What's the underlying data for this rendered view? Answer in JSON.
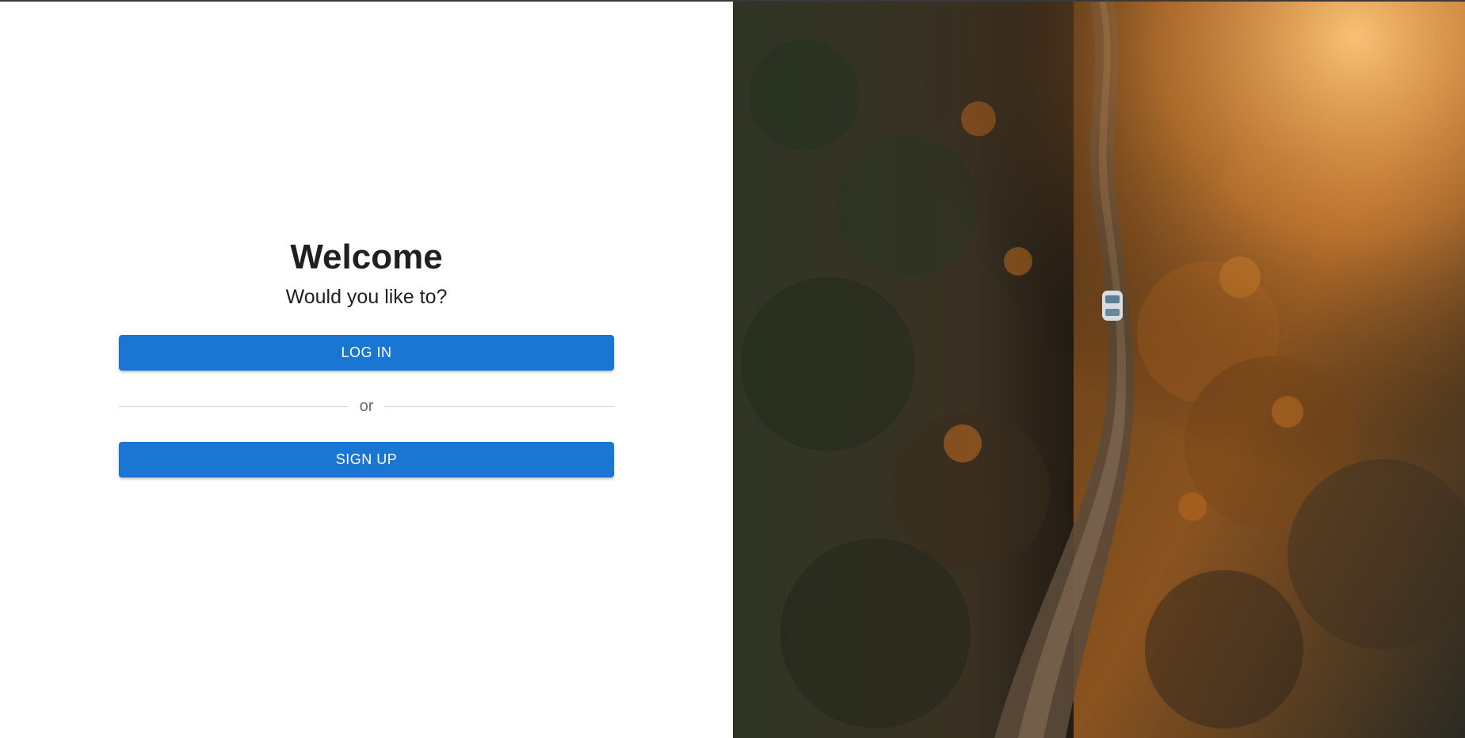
{
  "welcome": {
    "title": "Welcome",
    "subtitle": "Would you like to?"
  },
  "actions": {
    "login_label": "LOG IN",
    "divider_label": "or",
    "signup_label": "SIGN UP"
  },
  "hero_image": {
    "description_icon": "forest-road-photo-icon"
  },
  "colors": {
    "primary": "#1976d2",
    "text": "#202020",
    "divider": "#d9d9d9"
  }
}
